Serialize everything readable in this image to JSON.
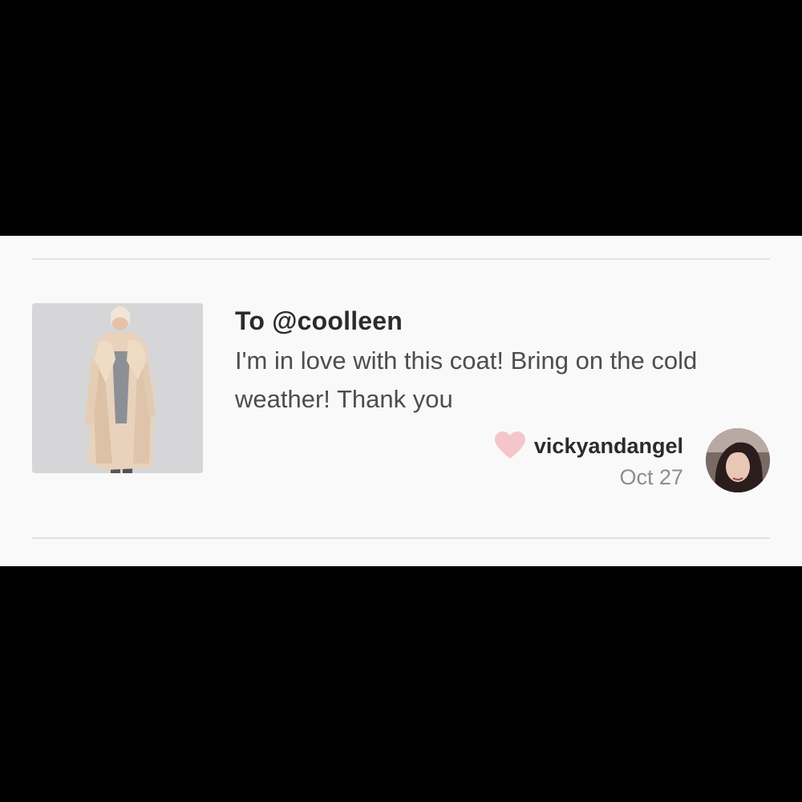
{
  "review": {
    "recipient": "To @coolleen",
    "message": "I'm in love with this coat! Bring on the cold weather! Thank you",
    "author": "vickyandangel",
    "date": "Oct 27",
    "product_image": "fur coat photo",
    "avatar_image": "author profile photo",
    "heart_icon": "heart-icon"
  },
  "colors": {
    "background": "#000000",
    "card": "#faf9fa",
    "divider": "#e2e0e2",
    "heart": "#f4c6cc",
    "primary_text": "#2b2b2b",
    "secondary_text": "#4d4d4d",
    "muted_text": "#8d8d8d"
  }
}
